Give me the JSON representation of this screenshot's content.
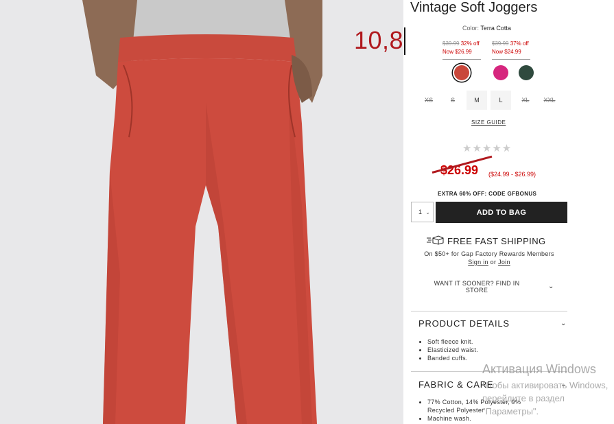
{
  "product": {
    "title": "Vintage Soft Joggers",
    "color_label": "Color:",
    "color_value": "Terra Cotta"
  },
  "overlay_number": "10,8",
  "price_options": [
    {
      "old": "$39.99",
      "off": "32% off",
      "now": "Now $26.99"
    },
    {
      "old": "$39.99",
      "off": "37% off",
      "now": "Now $24.99"
    }
  ],
  "swatches": [
    {
      "name": "terra-cotta",
      "color": "#c9473b",
      "selected": true
    },
    {
      "name": "pink",
      "color": "#d6267e",
      "selected": false
    },
    {
      "name": "green",
      "color": "#2f4a3e",
      "selected": false
    }
  ],
  "sizes": [
    {
      "label": "XS",
      "available": false
    },
    {
      "label": "S",
      "available": false
    },
    {
      "label": "M",
      "available": true
    },
    {
      "label": "L",
      "available": true
    },
    {
      "label": "XL",
      "available": false
    },
    {
      "label": "XXL",
      "available": false
    }
  ],
  "size_guide": "SIZE GUIDE",
  "rating": {
    "stars": "★★★★★",
    "value": 0
  },
  "price": {
    "main": "$26.99",
    "range": "($24.99 - $26.99)"
  },
  "promo": "EXTRA 60% OFF: CODE GFBONUS",
  "quantity": {
    "value": "1"
  },
  "add_to_bag": "ADD TO BAG",
  "shipping": {
    "title": "FREE FAST SHIPPING",
    "line1": "On $50+ for Gap Factory Rewards Members",
    "sign_in": "Sign in",
    "or": "or",
    "join": "Join"
  },
  "find_in_store": "WANT IT SOONER? FIND IN STORE",
  "product_details": {
    "title": "PRODUCT DETAILS",
    "items": [
      "Soft fleece knit.",
      "Elasticized waist.",
      "Banded cuffs."
    ]
  },
  "fabric_care": {
    "title": "FABRIC & CARE",
    "items": [
      "77% Cotton, 14% Polyester, 9% Recycled Polyester",
      "Machine wash."
    ]
  },
  "watermark": {
    "line1": "Активация Windows",
    "line2": "Чтобы активировать Windows, перейдите в раздел \"Параметры\"."
  },
  "colors": {
    "sale_red": "#cc0000",
    "button_dark": "#222222",
    "pants": "#c9473b"
  }
}
